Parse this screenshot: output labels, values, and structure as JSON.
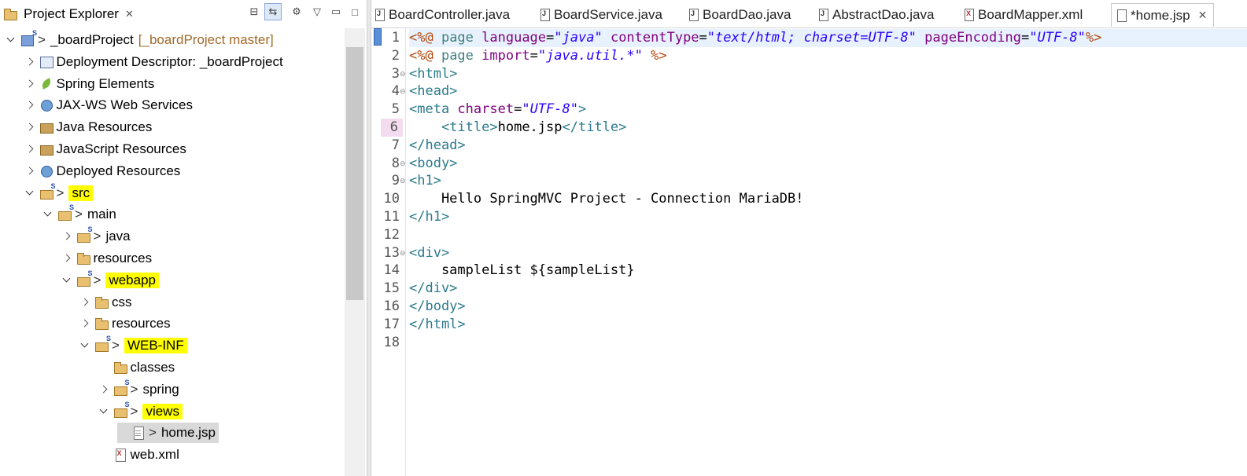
{
  "explorer": {
    "title": "Project Explorer",
    "close_glyph": "✕",
    "tree": [
      {
        "label": "_boardProject",
        "suffix": "[_boardProject master]",
        "icon": "project-icon",
        "depth": 0,
        "state": "open",
        "gt": true
      },
      {
        "label": "Deployment Descriptor: _boardProject",
        "icon": "descriptor-icon",
        "depth": 1,
        "state": "closed"
      },
      {
        "label": "Spring Elements",
        "icon": "spring-leaf-icon",
        "depth": 1,
        "state": "closed"
      },
      {
        "label": "JAX-WS Web Services",
        "icon": "web-services-icon",
        "depth": 1,
        "state": "closed"
      },
      {
        "label": "Java Resources",
        "icon": "java-resources-icon",
        "depth": 1,
        "state": "closed"
      },
      {
        "label": "JavaScript Resources",
        "icon": "javascript-resources-icon",
        "depth": 1,
        "state": "closed"
      },
      {
        "label": "Deployed Resources",
        "icon": "deployed-resources-icon",
        "depth": 1,
        "state": "closed"
      },
      {
        "label": "src",
        "icon": "package-folder-icon",
        "depth": 1,
        "state": "open",
        "gt": true,
        "highlight": true
      },
      {
        "label": "main",
        "icon": "package-folder-icon",
        "depth": 2,
        "state": "open",
        "gt": true
      },
      {
        "label": "java",
        "icon": "package-folder-icon",
        "depth": 3,
        "state": "closed",
        "gt": true
      },
      {
        "label": "resources",
        "icon": "folder-icon",
        "depth": 3,
        "state": "closed"
      },
      {
        "label": "webapp",
        "icon": "package-folder-icon",
        "depth": 3,
        "state": "open",
        "gt": true,
        "highlight": true
      },
      {
        "label": "css",
        "icon": "folder-icon",
        "depth": 4,
        "state": "closed"
      },
      {
        "label": "resources",
        "icon": "folder-icon",
        "depth": 4,
        "state": "closed"
      },
      {
        "label": "WEB-INF",
        "icon": "package-folder-icon",
        "depth": 4,
        "state": "open",
        "gt": true,
        "highlight": true
      },
      {
        "label": "classes",
        "icon": "folder-icon",
        "depth": 5,
        "state": "none"
      },
      {
        "label": "spring",
        "icon": "package-folder-icon",
        "depth": 5,
        "state": "closed",
        "gt": true
      },
      {
        "label": "views",
        "icon": "package-folder-icon",
        "depth": 5,
        "state": "open",
        "gt": true,
        "highlight": true
      },
      {
        "label": "home.jsp",
        "icon": "jsp-file-icon",
        "depth": 6,
        "state": "none",
        "gt": true,
        "selected": true
      },
      {
        "label": "web.xml",
        "icon": "xml-file-icon",
        "depth": 5,
        "state": "none"
      }
    ]
  },
  "editor": {
    "tabs": [
      {
        "label": "BoardController.java",
        "icon": "java-file-icon",
        "kind": "j"
      },
      {
        "label": "BoardService.java",
        "icon": "java-file-icon",
        "kind": "j"
      },
      {
        "label": "BoardDao.java",
        "icon": "java-file-icon",
        "kind": "j"
      },
      {
        "label": "AbstractDao.java",
        "icon": "java-file-icon",
        "kind": "j"
      },
      {
        "label": "BoardMapper.xml",
        "icon": "xml-file-icon",
        "kind": "x"
      },
      {
        "label": "*home.jsp",
        "icon": "jsp-file-icon",
        "kind": "f",
        "active": true
      }
    ],
    "tab_close_glyph": "✕",
    "lines": [
      {
        "n": "1",
        "fold": false,
        "tokens": [
          [
            "delim",
            "<%@ "
          ],
          [
            "kw",
            "page "
          ],
          [
            "attr",
            "language"
          ],
          [
            "text",
            "="
          ],
          [
            "val",
            "\"java\""
          ],
          [
            "text",
            " "
          ],
          [
            "attr",
            "contentType"
          ],
          [
            "text",
            "="
          ],
          [
            "val",
            "\"text/html; charset=UTF-8\""
          ],
          [
            "text",
            " "
          ],
          [
            "attr",
            "pageEncoding"
          ],
          [
            "text",
            "="
          ],
          [
            "val",
            "\"UTF-8\""
          ],
          [
            "delim",
            "%>"
          ]
        ]
      },
      {
        "n": "2",
        "fold": false,
        "tokens": [
          [
            "delim",
            "<%@ "
          ],
          [
            "kw",
            "page "
          ],
          [
            "attr",
            "import"
          ],
          [
            "text",
            "="
          ],
          [
            "val",
            "\"java.util.*\""
          ],
          [
            "text",
            " "
          ],
          [
            "delim",
            "%>"
          ]
        ]
      },
      {
        "n": "3",
        "fold": true,
        "tokens": [
          [
            "tag",
            "<html>"
          ]
        ]
      },
      {
        "n": "4",
        "fold": true,
        "tokens": [
          [
            "tag",
            "<head>"
          ]
        ]
      },
      {
        "n": "5",
        "fold": false,
        "tokens": [
          [
            "tag",
            "<meta "
          ],
          [
            "attr",
            "charset"
          ],
          [
            "text",
            "="
          ],
          [
            "val",
            "\"UTF-8\""
          ],
          [
            "tag",
            ">"
          ]
        ]
      },
      {
        "n": "6",
        "fold": false,
        "marked": true,
        "tokens": [
          [
            "text",
            "    "
          ],
          [
            "tag",
            "<title>"
          ],
          [
            "text",
            "home.jsp"
          ],
          [
            "tag",
            "</title>"
          ]
        ]
      },
      {
        "n": "7",
        "fold": false,
        "tokens": [
          [
            "tag",
            "</head>"
          ]
        ]
      },
      {
        "n": "8",
        "fold": true,
        "tokens": [
          [
            "tag",
            "<body>"
          ]
        ]
      },
      {
        "n": "9",
        "fold": true,
        "tokens": [
          [
            "tag",
            "<h1>"
          ]
        ]
      },
      {
        "n": "10",
        "fold": false,
        "tokens": [
          [
            "text",
            "    Hello SpringMVC Project - Connection MariaDB!"
          ]
        ]
      },
      {
        "n": "11",
        "fold": false,
        "tokens": [
          [
            "tag",
            "</h1>"
          ]
        ]
      },
      {
        "n": "12",
        "fold": false,
        "tokens": []
      },
      {
        "n": "13",
        "fold": true,
        "tokens": [
          [
            "tag",
            "<div>"
          ]
        ]
      },
      {
        "n": "14",
        "fold": false,
        "tokens": [
          [
            "text",
            "    sampleList ${sampleList}"
          ]
        ]
      },
      {
        "n": "15",
        "fold": false,
        "tokens": [
          [
            "tag",
            "</div>"
          ]
        ]
      },
      {
        "n": "16",
        "fold": false,
        "tokens": [
          [
            "tag",
            "</body>"
          ]
        ]
      },
      {
        "n": "17",
        "fold": false,
        "tokens": [
          [
            "tag",
            "</html>"
          ]
        ]
      },
      {
        "n": "18",
        "fold": false,
        "tokens": []
      }
    ]
  },
  "colors": {
    "highlight": "#ffff00",
    "selection": "#d9d9d9",
    "current_line": "#e8f2fe",
    "jsp_delimiter": "#b24a0f",
    "tag": "#2b7a8c",
    "attribute": "#7f007f",
    "string": "#2a00ff"
  }
}
